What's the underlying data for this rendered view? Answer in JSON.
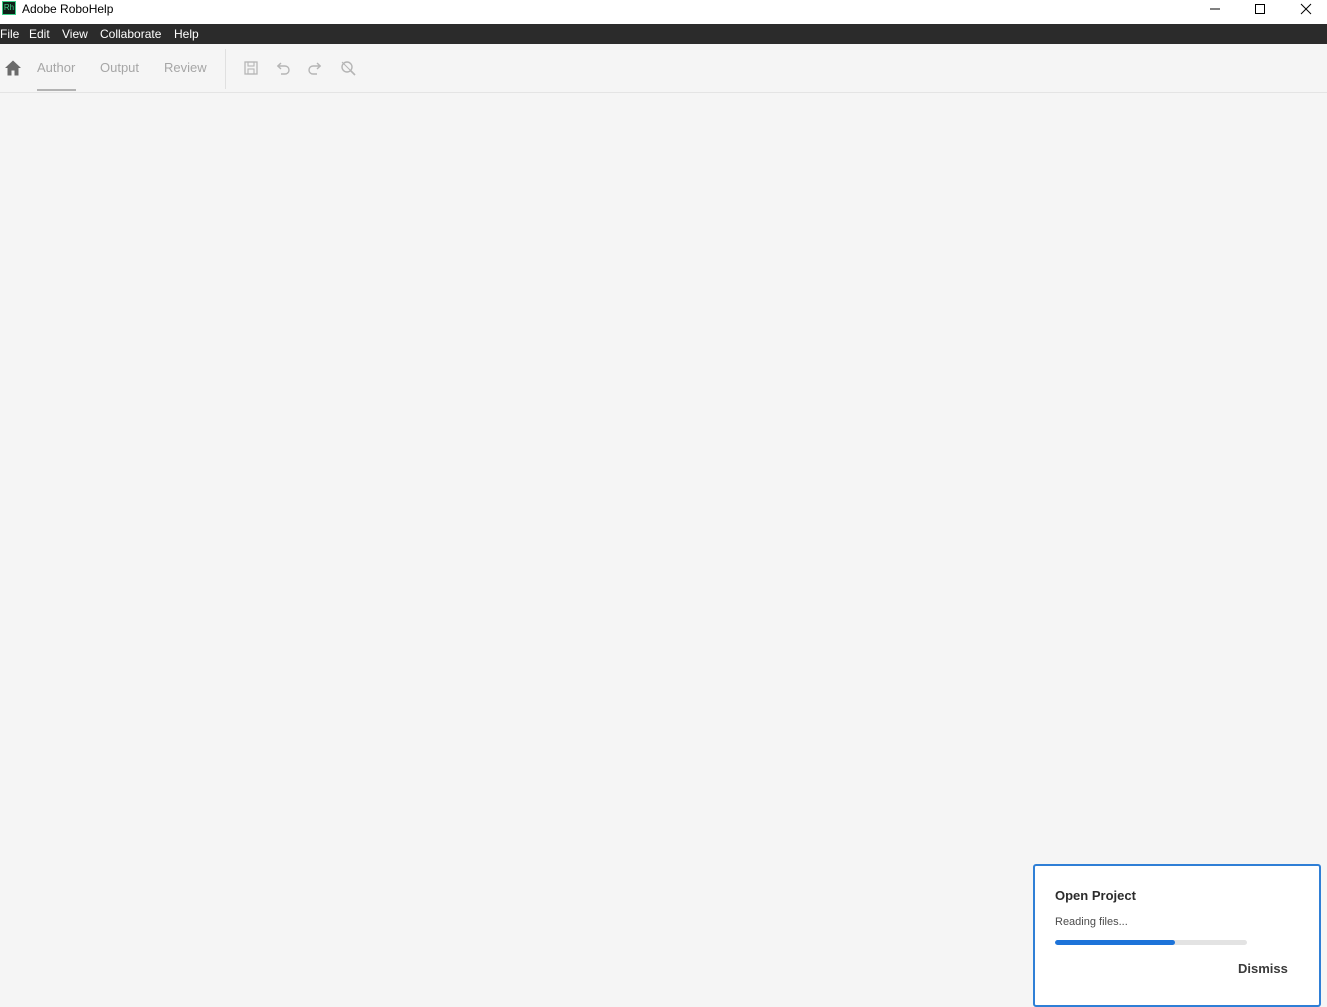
{
  "window": {
    "title": "Adobe RoboHelp",
    "logo_text": "Rh",
    "controls": [
      "minimize-icon",
      "maximize-icon",
      "close-icon"
    ]
  },
  "menubar": {
    "items": [
      {
        "label": "File"
      },
      {
        "label": "Edit"
      },
      {
        "label": "View"
      },
      {
        "label": "Collaborate"
      },
      {
        "label": "Help"
      }
    ]
  },
  "toolbar": {
    "home_icon": "home-icon",
    "tabs": [
      {
        "label": "Author",
        "active": true
      },
      {
        "label": "Output",
        "active": false
      },
      {
        "label": "Review",
        "active": false
      }
    ],
    "tools": [
      "save-icon",
      "undo-icon",
      "redo-icon",
      "preview-search-icon"
    ]
  },
  "toast": {
    "title": "Open Project",
    "status": "Reading files...",
    "progress": 0.625,
    "dismiss_label": "Dismiss",
    "accent_color": "#2f7fd6",
    "progress_color": "#1d73d9"
  },
  "colors": {
    "menubar_bg": "#2b2b2b",
    "workspace_bg": "#f5f5f5"
  }
}
